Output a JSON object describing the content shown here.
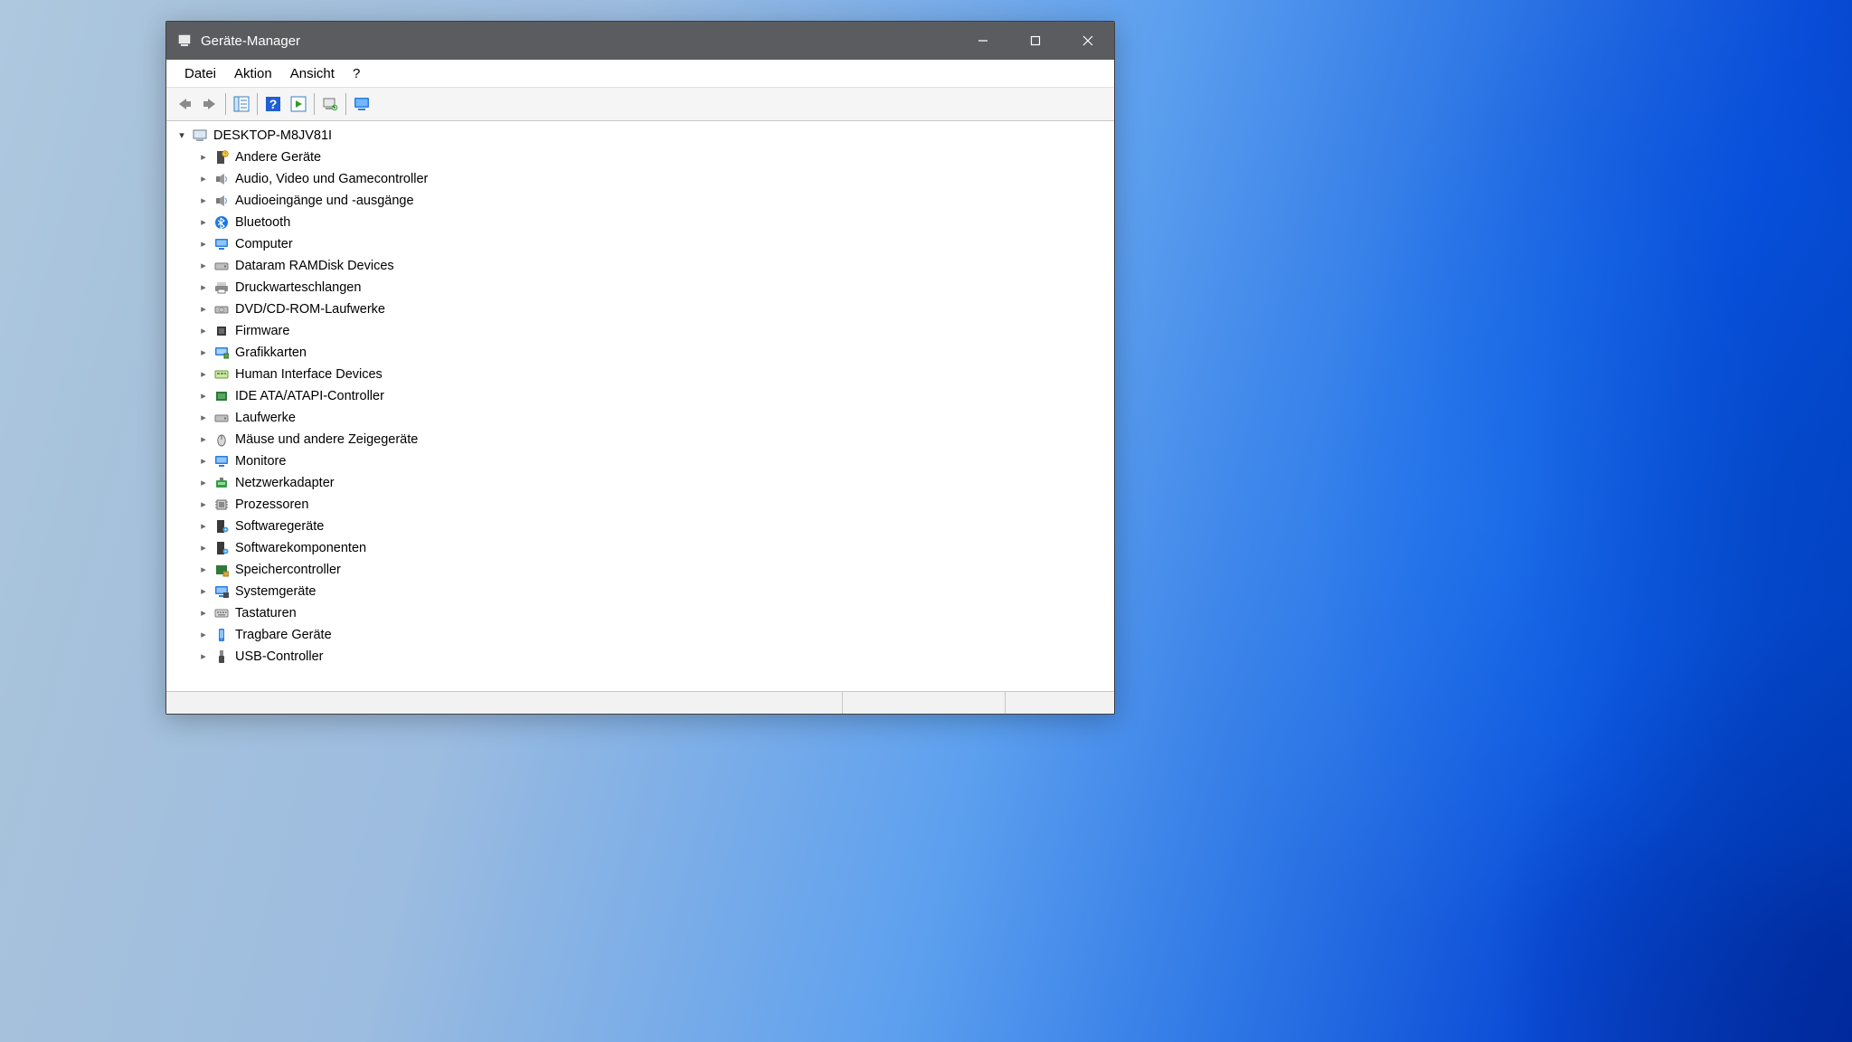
{
  "window": {
    "title": "Geräte-Manager"
  },
  "menu": {
    "items": [
      "Datei",
      "Aktion",
      "Ansicht",
      "?"
    ]
  },
  "toolbar": {
    "back": "back",
    "forward": "forward",
    "show_hide": "show-hide",
    "help": "help",
    "action": "action",
    "refresh": "refresh",
    "monitor": "monitor"
  },
  "tree": {
    "root": {
      "label": "DESKTOP-M8JV81I",
      "expanded": true,
      "icon": "computer"
    },
    "children": [
      {
        "label": "Andere Geräte",
        "icon": "unknown"
      },
      {
        "label": "Audio, Video und Gamecontroller",
        "icon": "audio"
      },
      {
        "label": "Audioeingänge und -ausgänge",
        "icon": "audio"
      },
      {
        "label": "Bluetooth",
        "icon": "bluetooth"
      },
      {
        "label": "Computer",
        "icon": "monitor-blue"
      },
      {
        "label": "Dataram RAMDisk Devices",
        "icon": "drive"
      },
      {
        "label": "Druckwarteschlangen",
        "icon": "printer"
      },
      {
        "label": "DVD/CD-ROM-Laufwerke",
        "icon": "disc"
      },
      {
        "label": "Firmware",
        "icon": "chip"
      },
      {
        "label": "Grafikkarten",
        "icon": "display"
      },
      {
        "label": "Human Interface Devices",
        "icon": "hid"
      },
      {
        "label": "IDE ATA/ATAPI-Controller",
        "icon": "ide"
      },
      {
        "label": "Laufwerke",
        "icon": "drive"
      },
      {
        "label": "Mäuse und andere Zeigegeräte",
        "icon": "mouse"
      },
      {
        "label": "Monitore",
        "icon": "monitor-blue"
      },
      {
        "label": "Netzwerkadapter",
        "icon": "network"
      },
      {
        "label": "Prozessoren",
        "icon": "cpu"
      },
      {
        "label": "Softwaregeräte",
        "icon": "software"
      },
      {
        "label": "Softwarekomponenten",
        "icon": "software"
      },
      {
        "label": "Speichercontroller",
        "icon": "storage"
      },
      {
        "label": "Systemgeräte",
        "icon": "system"
      },
      {
        "label": "Tastaturen",
        "icon": "keyboard"
      },
      {
        "label": "Tragbare Geräte",
        "icon": "portable"
      },
      {
        "label": "USB-Controller",
        "icon": "usb"
      }
    ]
  }
}
